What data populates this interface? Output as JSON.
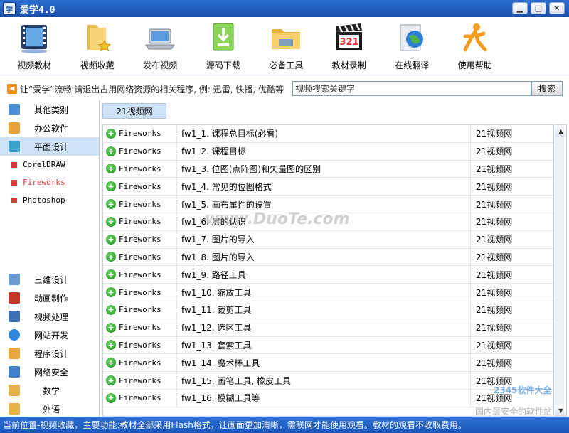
{
  "window": {
    "title": "爱学4.0",
    "logo_glyph": "学"
  },
  "toolbar": [
    {
      "label": "视频教材",
      "icon": "film-icon"
    },
    {
      "label": "视频收藏",
      "icon": "folder-star-icon"
    },
    {
      "label": "发布视频",
      "icon": "laptop-icon"
    },
    {
      "label": "源码下载",
      "icon": "download-icon"
    },
    {
      "label": "必备工具",
      "icon": "folder-icon"
    },
    {
      "label": "教材录制",
      "icon": "clapperboard-icon"
    },
    {
      "label": "在线翻译",
      "icon": "globe-icon"
    },
    {
      "label": "使用帮助",
      "icon": "help-runner-icon"
    }
  ],
  "notice": "让“爱学”流畅  请退出占用网络资源的相关程序, 例: 迅雷, 快播, 优酷等",
  "search": {
    "placeholder": "视频搜索关键字",
    "button": "搜索"
  },
  "sidebar": {
    "top": [
      {
        "label": "其他类别",
        "color": "#4a8fd8"
      },
      {
        "label": "办公软件",
        "color": "#e8a23a"
      },
      {
        "label": "平面设计",
        "color": "#3aa0c8",
        "selected": true
      }
    ],
    "subs": [
      {
        "label": "CorelDRAW"
      },
      {
        "label": "Fireworks",
        "active": true
      },
      {
        "label": "Photoshop"
      }
    ],
    "bottom": [
      {
        "label": "三维设计",
        "color": "#6c9bd1"
      },
      {
        "label": "动画制作",
        "color": "#c0392b"
      },
      {
        "label": "视频处理",
        "color": "#3d6fb5"
      },
      {
        "label": "网站开发",
        "color": "#2e86de"
      },
      {
        "label": "程序设计",
        "color": "#e9a83b"
      },
      {
        "label": "网络安全",
        "color": "#3f7fc7"
      },
      {
        "label": "数学",
        "color": "#e6b04a"
      },
      {
        "label": "外语",
        "color": "#e6b04a"
      }
    ]
  },
  "content": {
    "tab": "21视频网",
    "rows": [
      {
        "category": "Fireworks",
        "title": "fw1_1. 课程总目标(必看)",
        "source": "21视频网"
      },
      {
        "category": "Fireworks",
        "title": "fw1_2. 课程目标",
        "source": "21视频网"
      },
      {
        "category": "Fireworks",
        "title": "fw1_3. 位图(点阵图)和矢量图的区别",
        "source": "21视频网"
      },
      {
        "category": "Fireworks",
        "title": "fw1_4. 常见的位图格式",
        "source": "21视频网"
      },
      {
        "category": "Fireworks",
        "title": "fw1_5. 画布属性的设置",
        "source": "21视频网"
      },
      {
        "category": "Fireworks",
        "title": "fw1_6. 层的认识",
        "source": "21视频网"
      },
      {
        "category": "Fireworks",
        "title": "fw1_7. 图片的导入",
        "source": "21视频网"
      },
      {
        "category": "Fireworks",
        "title": "fw1_8. 图片的导入",
        "source": "21视频网"
      },
      {
        "category": "Fireworks",
        "title": "fw1_9. 路径工具",
        "source": "21视频网"
      },
      {
        "category": "Fireworks",
        "title": "fw1_10. 缩放工具",
        "source": "21视频网"
      },
      {
        "category": "Fireworks",
        "title": "fw1_11. 裁剪工具",
        "source": "21视频网"
      },
      {
        "category": "Fireworks",
        "title": "fw1_12. 选区工具",
        "source": "21视频网"
      },
      {
        "category": "Fireworks",
        "title": "fw1_13. 套索工具",
        "source": "21视频网"
      },
      {
        "category": "Fireworks",
        "title": "fw1_14. 魔术棒工具",
        "source": "21视频网"
      },
      {
        "category": "Fireworks",
        "title": "fw1_15. 画笔工具, 橡皮工具",
        "source": "21视频网"
      },
      {
        "category": "Fireworks",
        "title": "fw1_16. 模糊工具等",
        "source": "21视频网"
      }
    ]
  },
  "watermark": {
    "text": "www.DuoTe.com",
    "logo": "2345软件大全",
    "logo_sub": "国内最安全的软件站"
  },
  "status": "当前位置-视频收藏，主要功能:教材全部采用Flash格式，让画面更加清晰，需联网才能使用观看。教材的观看不收取费用。"
}
